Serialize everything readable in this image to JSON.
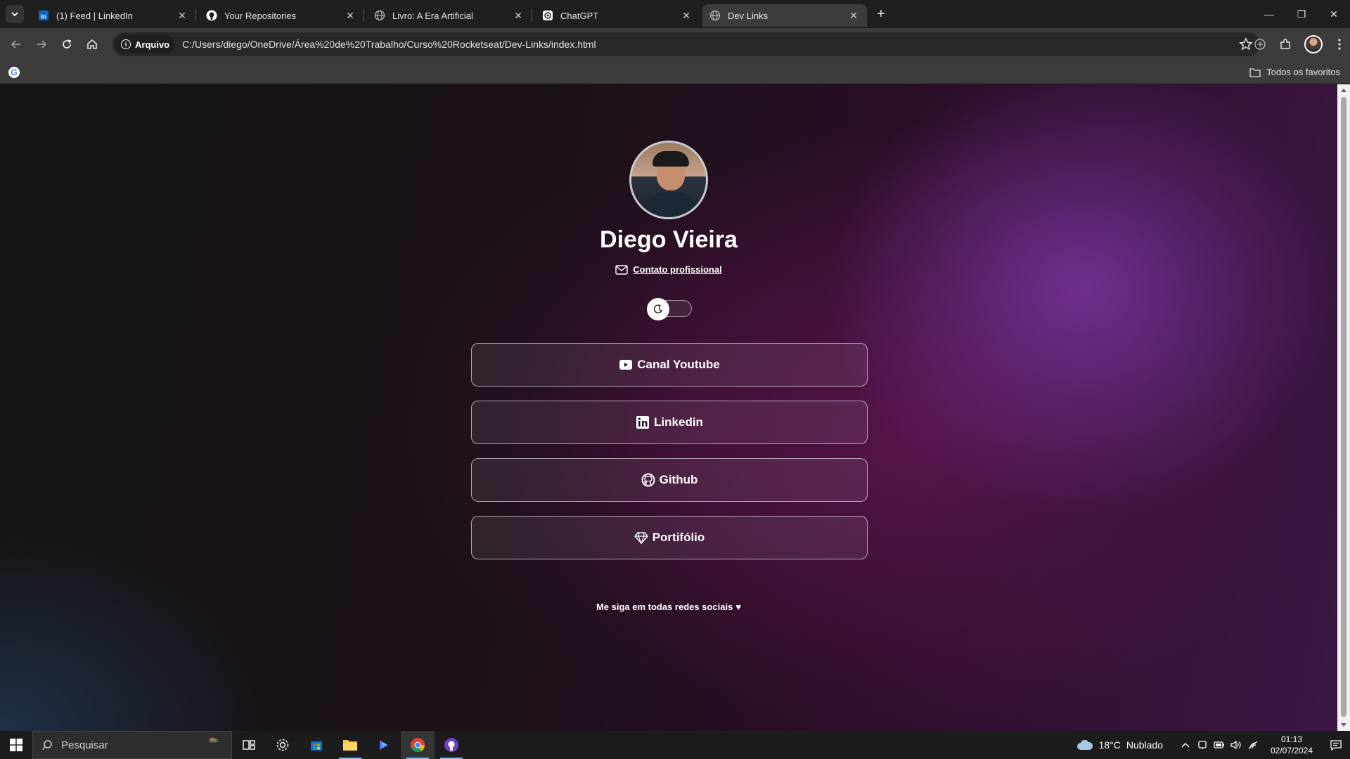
{
  "browser": {
    "tabs": [
      {
        "title": "(1) Feed | LinkedIn",
        "icon": "linkedin-icon",
        "active": false
      },
      {
        "title": "Your Repositories",
        "icon": "github-icon",
        "active": false
      },
      {
        "title": "Livro: A Era Artificial",
        "icon": "globe-icon",
        "active": false
      },
      {
        "title": "ChatGPT",
        "icon": "chatgpt-icon",
        "active": false
      },
      {
        "title": "Dev Links",
        "icon": "globe-icon",
        "active": true
      }
    ],
    "security_chip": "Arquivo",
    "url": "C:/Users/diego/OneDrive/Área%20de%20Trabalho/Curso%20Rocketseat/Dev-Links/index.html",
    "bookmarks_folder": "Todos os favoritos"
  },
  "profile": {
    "name": "Diego Vieira",
    "contact_label": "Contato profissional"
  },
  "links": [
    {
      "label": "Canal Youtube",
      "icon": "youtube-icon"
    },
    {
      "label": "Linkedin",
      "icon": "linkedin-icon"
    },
    {
      "label": "Github",
      "icon": "github-icon"
    },
    {
      "label": "Portifólio",
      "icon": "diamond-icon"
    }
  ],
  "footer": {
    "text": "Me siga em todas redes sociais",
    "heart": "♥"
  },
  "taskbar": {
    "search_placeholder": "Pesquisar",
    "weather_temp": "18°C",
    "weather_desc": "Nublado",
    "time": "01:13",
    "date": "02/07/2024"
  },
  "colors": {
    "accent_purple": "#8038aa",
    "page_dark": "#141414",
    "chrome_bg": "#3c3c3c"
  }
}
